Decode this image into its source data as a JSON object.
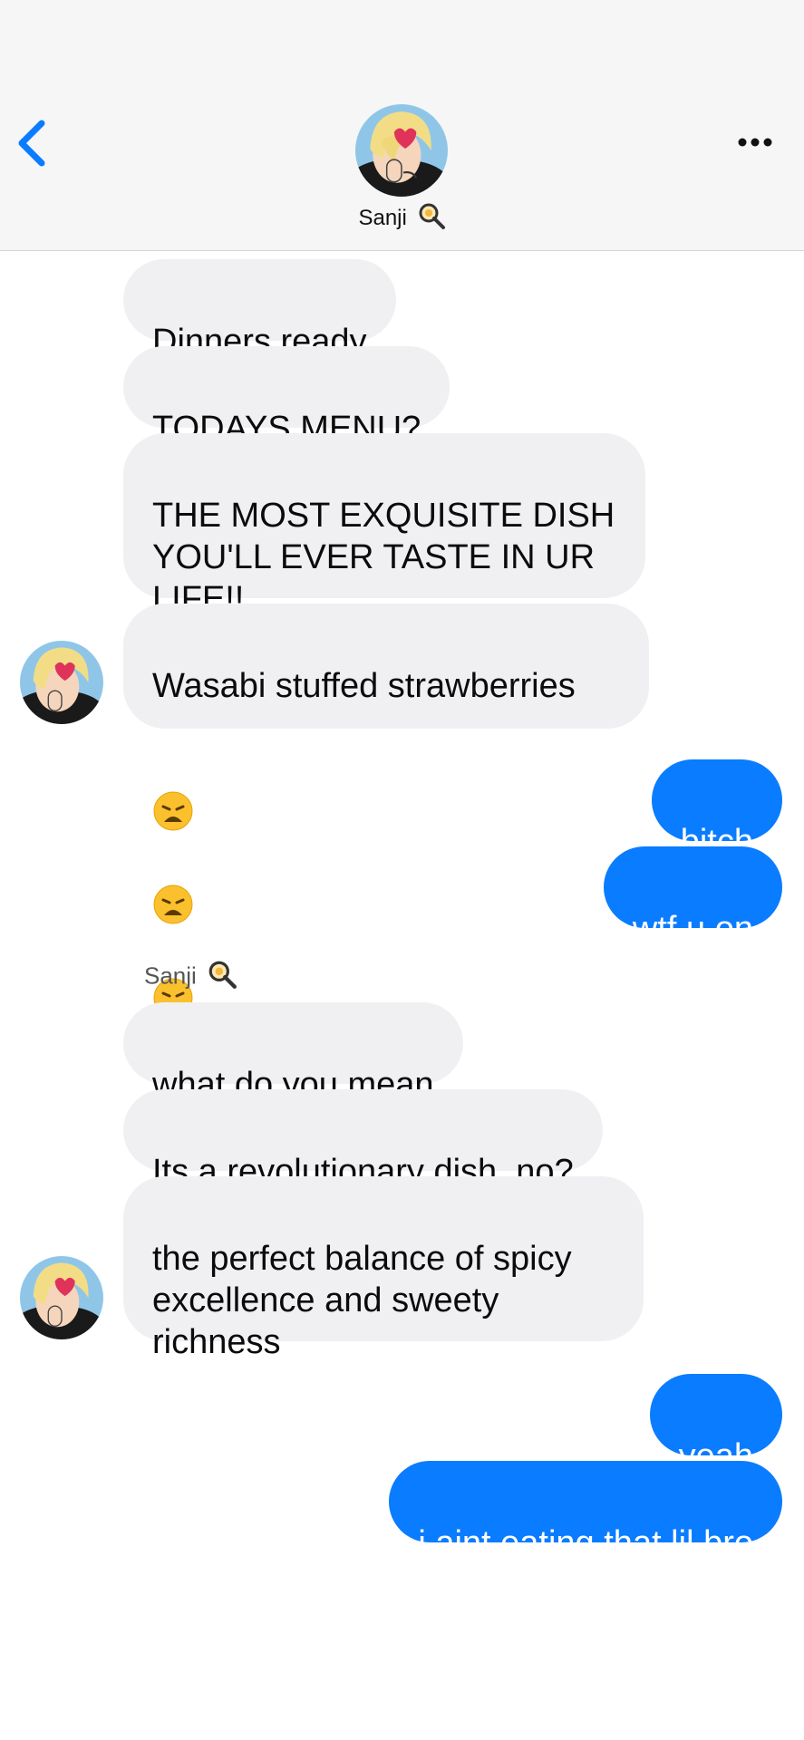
{
  "header": {
    "contact_name": "Sanji",
    "back_icon": "chevron-left-icon",
    "more_icon": "ellipsis-icon",
    "accent_color": "#0a7cff"
  },
  "messages": [
    {
      "from": "them",
      "text": "Dinners ready"
    },
    {
      "from": "them",
      "text": "TODAYS MENU?"
    },
    {
      "from": "them",
      "text": "THE MOST EXQUISITE DISH\nYOU'LL EVER TASTE IN UR\nLIFE!!"
    },
    {
      "from": "them",
      "text": "Wasabi stuffed strawberries",
      "emoji": "weary-face x3"
    },
    {
      "from": "me",
      "text": "bitch"
    },
    {
      "from": "me",
      "text": "wtf u on"
    },
    {
      "from": "them",
      "sender_label": "Sanji",
      "text": "what do you mean"
    },
    {
      "from": "them",
      "text": "Its a revolutionary dish, no?"
    },
    {
      "from": "them",
      "text": "the perfect balance of spicy\nexcellence and sweety\nrichness"
    },
    {
      "from": "me",
      "text": "yeah"
    },
    {
      "from": "me",
      "text": "i aint eating that lil bro"
    }
  ]
}
